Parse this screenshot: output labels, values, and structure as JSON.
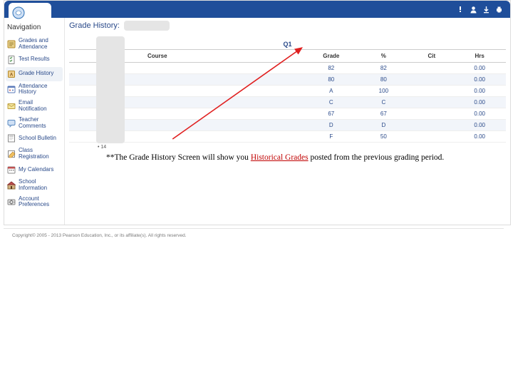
{
  "topbar_icons": [
    "!",
    "user",
    "download",
    "print"
  ],
  "sidebar": {
    "header": "Navigation",
    "items": [
      {
        "icon": "grades",
        "label": "Grades and Attendance"
      },
      {
        "icon": "tests",
        "label": "Test Results"
      },
      {
        "icon": "history",
        "label": "Grade History"
      },
      {
        "icon": "att-hist",
        "label": "Attendance History"
      },
      {
        "icon": "email",
        "label": "Email Notification"
      },
      {
        "icon": "comments",
        "label": "Teacher Comments"
      },
      {
        "icon": "bulletin",
        "label": "School Bulletin"
      },
      {
        "icon": "classreg",
        "label": "Class Registration"
      },
      {
        "icon": "calendar",
        "label": "My Calendars"
      },
      {
        "icon": "school",
        "label": "School Information"
      },
      {
        "icon": "prefs",
        "label": "Account Preferences"
      }
    ]
  },
  "page": {
    "title_prefix": "Grade History:",
    "term": "Q1",
    "headers": {
      "course": "Course",
      "grade": "Grade",
      "pct": "%",
      "cit": "Cit",
      "hrs": "Hrs"
    },
    "rows": [
      {
        "grade": "82",
        "pct": "82",
        "hrs": "0.00"
      },
      {
        "grade": "80",
        "pct": "80",
        "hrs": "0.00"
      },
      {
        "grade": "A",
        "pct": "100",
        "hrs": "0.00"
      },
      {
        "grade": "C",
        "pct": "C",
        "hrs": "0.00"
      },
      {
        "grade": "67",
        "pct": "67",
        "hrs": "0.00"
      },
      {
        "grade": "D",
        "pct": "D",
        "hrs": "0.00"
      },
      {
        "grade": "F",
        "pct": "50",
        "hrs": "0.00"
      }
    ],
    "note_prefix": "**The Grade History Screen will show you ",
    "note_highlight": "Historical Grades",
    "note_suffix": " posted from the previous grading period.",
    "small_note": "• 14"
  },
  "footer": "Copyright© 2005 - 2013 Pearson Education, Inc., or its affiliate(s). All rights reserved."
}
